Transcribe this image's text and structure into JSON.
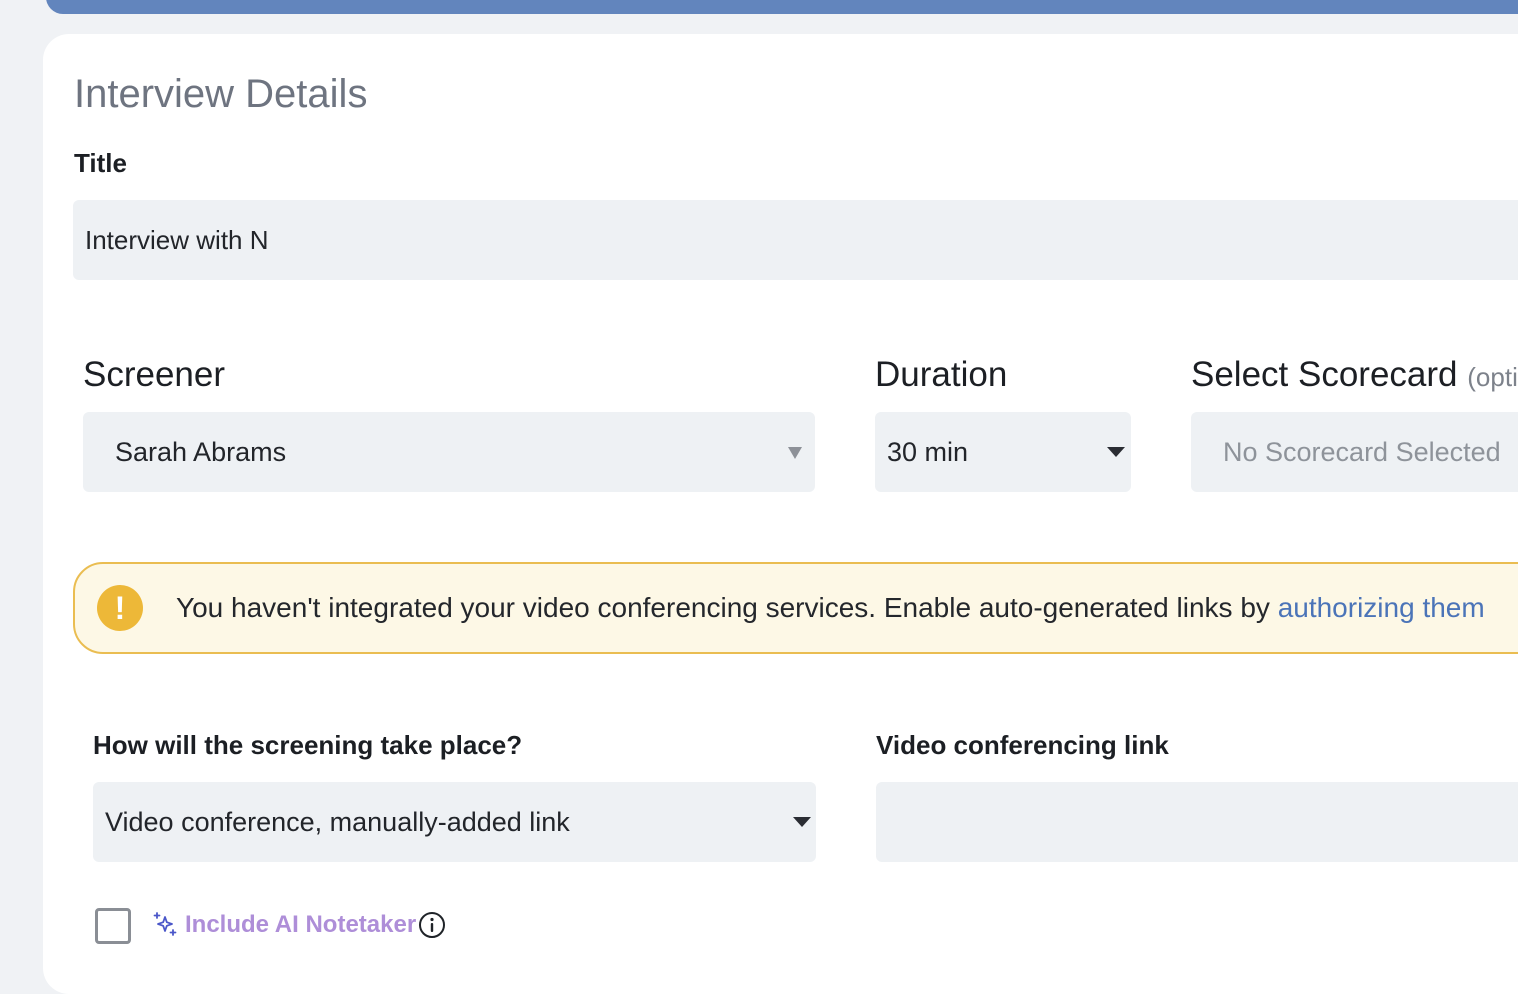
{
  "section": {
    "title": "Interview Details"
  },
  "title_field": {
    "label": "Title",
    "value": "Interview with N"
  },
  "screener": {
    "label": "Screener",
    "value": "Sarah Abrams"
  },
  "duration": {
    "label": "Duration",
    "value": "30 min"
  },
  "scorecard": {
    "label": "Select Scorecard",
    "optional_note": "(optional)",
    "placeholder": "No Scorecard Selected"
  },
  "alert": {
    "icon": "exclamation-icon",
    "text": "You haven't integrated your video conferencing services. Enable auto-generated links by ",
    "link_text": "authorizing them",
    "border_color": "#eabd51",
    "background_color": "#fdf8e6"
  },
  "screening_method": {
    "label": "How will the screening take place?",
    "value": "Video conference, manually-added link"
  },
  "video_link": {
    "label": "Video conferencing link",
    "value": ""
  },
  "notetaker": {
    "label": "Include AI Notetaker",
    "checked": false,
    "icon": "sparkle-icon",
    "info_icon": "info-icon",
    "label_color": "#ae8ed8"
  },
  "colors": {
    "accent_bar": "#6285bd",
    "link": "#4b74b8",
    "field_background": "#eef1f4"
  }
}
